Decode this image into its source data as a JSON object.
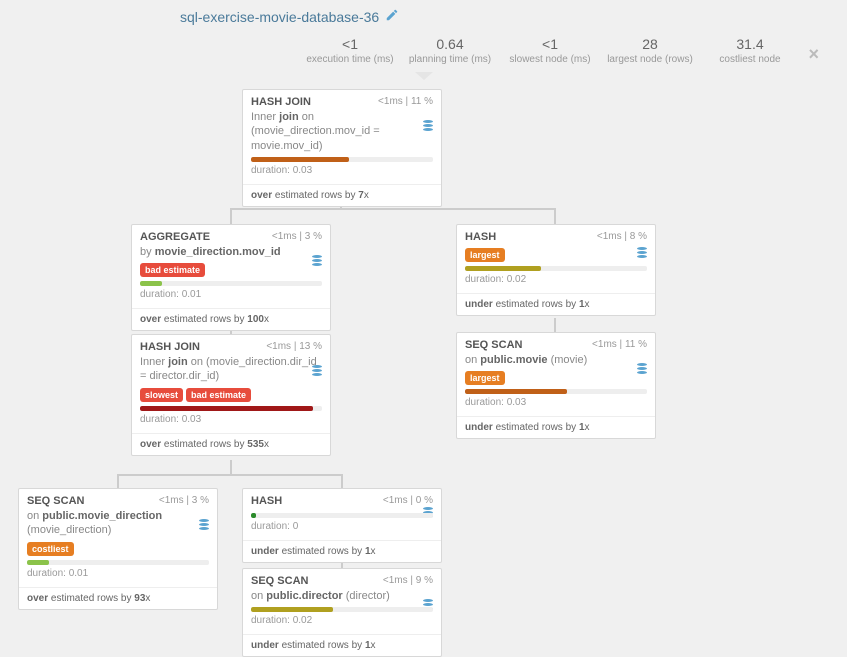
{
  "title": "sql-exercise-movie-database-36",
  "stats": [
    {
      "val": "<1",
      "lbl": "execution time (ms)"
    },
    {
      "val": "0.64",
      "lbl": "planning time (ms)"
    },
    {
      "val": "<1",
      "lbl": "slowest node (ms)"
    },
    {
      "val": "28",
      "lbl": "largest node (rows)"
    },
    {
      "val": "31.4",
      "lbl": "costliest node"
    }
  ],
  "nodes": {
    "n1": {
      "title": "HASH JOIN",
      "time": "<1ms",
      "pct": "11 %",
      "desc_pre": "Inner ",
      "desc_b1": "join",
      "desc_mid": " on (movie_direction.mov_id = movie.mov_id)",
      "bar_color": "#c06018",
      "bar_w": "54%",
      "dur": "duration: 0.03",
      "foot_pre": "over ",
      "foot_mid": "estimated rows by ",
      "foot_b": "7",
      "foot_suf": "x"
    },
    "n2": {
      "title": "AGGREGATE",
      "time": "<1ms",
      "pct": "3 %",
      "desc_pre": "by ",
      "desc_b1": "movie_direction.mov_id",
      "desc_mid": "",
      "tag1": "bad estimate",
      "bar_color": "#8bc34a",
      "bar_w": "12%",
      "dur": "duration: 0.01",
      "foot_pre": "over ",
      "foot_mid": "estimated rows by ",
      "foot_b": "100",
      "foot_suf": "x"
    },
    "n3": {
      "title": "HASH",
      "time": "<1ms",
      "pct": "8 %",
      "tag1": "largest",
      "bar_color": "#b0a020",
      "bar_w": "42%",
      "dur": "duration: 0.02",
      "foot_pre": "under ",
      "foot_mid": "estimated rows by ",
      "foot_b": "1",
      "foot_suf": "x"
    },
    "n4": {
      "title": "HASH JOIN",
      "time": "<1ms",
      "pct": "13 %",
      "desc_pre": "Inner ",
      "desc_b1": "join",
      "desc_mid": " on (movie_direction.dir_id = director.dir_id)",
      "tag1": "slowest",
      "tag2": "bad estimate",
      "bar_color": "#a01818",
      "bar_w": "95%",
      "dur": "duration: 0.03",
      "foot_pre": "over ",
      "foot_mid": "estimated rows by ",
      "foot_b": "535",
      "foot_suf": "x"
    },
    "n5": {
      "title": "SEQ SCAN",
      "time": "<1ms",
      "pct": "11 %",
      "desc_pre": "on ",
      "desc_b1": "public.movie",
      "desc_mid": " (movie)",
      "tag1": "largest",
      "bar_color": "#c06018",
      "bar_w": "56%",
      "dur": "duration: 0.03",
      "foot_pre": "under ",
      "foot_mid": "estimated rows by ",
      "foot_b": "1",
      "foot_suf": "x"
    },
    "n6": {
      "title": "SEQ SCAN",
      "time": "<1ms",
      "pct": "3 %",
      "desc_pre": "on ",
      "desc_b1": "public.movie_direction",
      "desc_mid": " (movie_direction)",
      "tag1": "costliest",
      "bar_color": "#8bc34a",
      "bar_w": "12%",
      "dur": "duration: 0.01",
      "foot_pre": "over ",
      "foot_mid": "estimated rows by ",
      "foot_b": "93",
      "foot_suf": "x"
    },
    "n7": {
      "title": "HASH",
      "time": "<1ms",
      "pct": "0 %",
      "bar_color": "#2a8a2a",
      "bar_w": "3%",
      "dur": "duration: 0",
      "foot_pre": "under ",
      "foot_mid": "estimated rows by ",
      "foot_b": "1",
      "foot_suf": "x"
    },
    "n8": {
      "title": "SEQ SCAN",
      "time": "<1ms",
      "pct": "9 %",
      "desc_pre": "on ",
      "desc_b1": "public.director",
      "desc_mid": " (director)",
      "bar_color": "#b0a020",
      "bar_w": "45%",
      "dur": "duration: 0.02",
      "foot_pre": "under ",
      "foot_mid": "estimated rows by ",
      "foot_b": "1",
      "foot_suf": "x"
    }
  }
}
